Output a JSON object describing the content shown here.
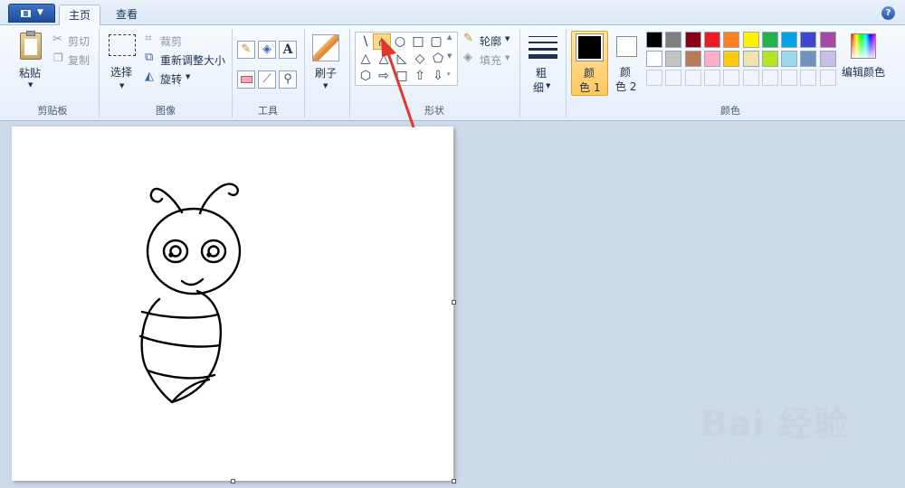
{
  "tabs": {
    "home": "主页",
    "view": "查看"
  },
  "help_icon": "?",
  "clipboard": {
    "paste": "粘贴",
    "cut": "剪切",
    "copy": "复制",
    "group": "剪贴板"
  },
  "image": {
    "select": "选择",
    "crop": "裁剪",
    "resize": "重新调整大小",
    "rotate": "旋转",
    "group": "图像"
  },
  "tools": {
    "group": "工具",
    "text_tool": "A"
  },
  "brushes": {
    "label": "刷子"
  },
  "shapes": {
    "outline": "轮廓",
    "fill": "填充",
    "group": "形状",
    "glyphs": [
      "\\",
      "∩",
      "○",
      "□",
      "▢",
      "△",
      "◺",
      "◇",
      "⬠",
      "⬡",
      "⇨",
      "⇧",
      "⇩"
    ]
  },
  "size": {
    "line1": "粗",
    "line2": "细"
  },
  "colors": {
    "color1_a": "颜",
    "color1_b": "色 1",
    "color2_a": "颜",
    "color2_b": "色 2",
    "edit": "编辑颜色",
    "group": "颜色",
    "palette_row1": [
      "#000000",
      "#7f7f7f",
      "#880015",
      "#ed1c24",
      "#ff7f27",
      "#fff200",
      "#22b14c",
      "#00a2e8",
      "#3f48cc",
      "#a349a4"
    ],
    "palette_row2": [
      "#ffffff",
      "#c3c3c3",
      "#b97a57",
      "#ffaec9",
      "#ffc90e",
      "#efe4b0",
      "#b5e61d",
      "#99d9ea",
      "#7092be",
      "#c8bfe7"
    ]
  },
  "watermark": {
    "brand": "Bai 经验",
    "url": "jingyan.baidu.com"
  }
}
